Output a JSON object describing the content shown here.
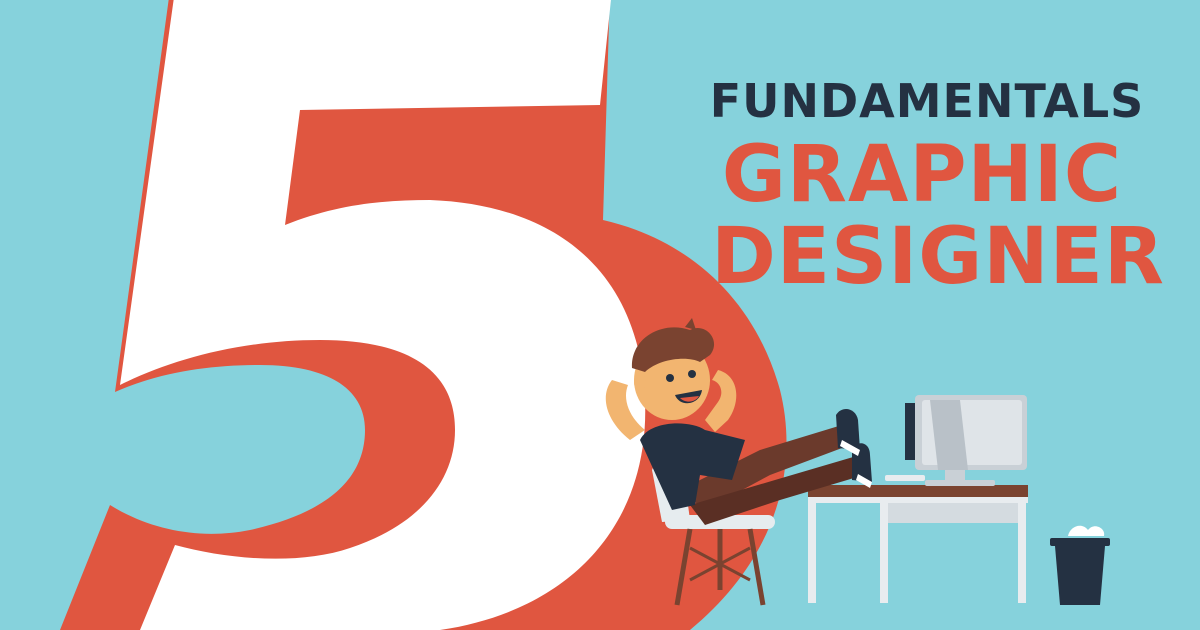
{
  "big_number": "5",
  "headline": {
    "line1": "FUNDAMENTALS",
    "line2": "GRAPHIC",
    "line3": "DESIGNER"
  },
  "illustration": {
    "subject": "designer-relaxing-with-feet-on-desk",
    "objects": [
      "chair",
      "desk",
      "computer-monitor",
      "keyboard",
      "trash-bin"
    ]
  },
  "colors": {
    "background": "#86d2dc",
    "accent_red": "#e05640",
    "navy_text": "#243142",
    "white": "#ffffff"
  }
}
